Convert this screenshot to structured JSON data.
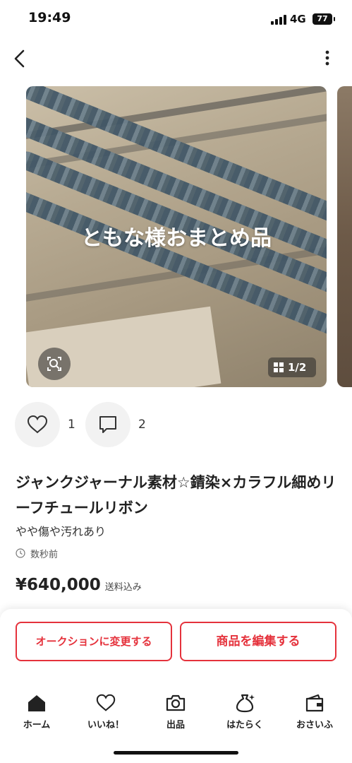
{
  "status_bar": {
    "time": "19:49",
    "network": "4G",
    "battery": "77",
    "icons": [
      "signal-icon",
      "battery-icon"
    ]
  },
  "nav": {
    "icons": [
      "chevron-left-icon",
      "more-vertical-icon"
    ]
  },
  "gallery": {
    "overlay_caption": "ともな様おまとめ品",
    "counter": "1/2",
    "icons": [
      "lens-search-icon",
      "grid-icon"
    ]
  },
  "social": {
    "like_count": "1",
    "comment_count": "2",
    "icons": [
      "heart-icon",
      "comment-icon"
    ]
  },
  "product": {
    "title": "ジャンクジャーナル素材☆錆染×カラフル細めリーフチュールリボン",
    "condition": "やや傷や汚れあり",
    "listed_time": "数秒前",
    "price": "¥640,000",
    "shipping": "送料込み"
  },
  "actions": {
    "auction_label": "オークションに変更する",
    "edit_label": "商品を編集する"
  },
  "tab_bar": {
    "items": [
      {
        "label": "ホーム",
        "icon": "home-icon"
      },
      {
        "label": "いいね！",
        "icon": "heart-icon"
      },
      {
        "label": "出品",
        "icon": "camera-icon"
      },
      {
        "label": "はたらく",
        "icon": "money-bag-icon"
      },
      {
        "label": "おさいふ",
        "icon": "wallet-icon"
      }
    ]
  },
  "colors": {
    "accent": "#e5323c",
    "text": "#222222",
    "circle_bg": "#f2f2f2"
  }
}
